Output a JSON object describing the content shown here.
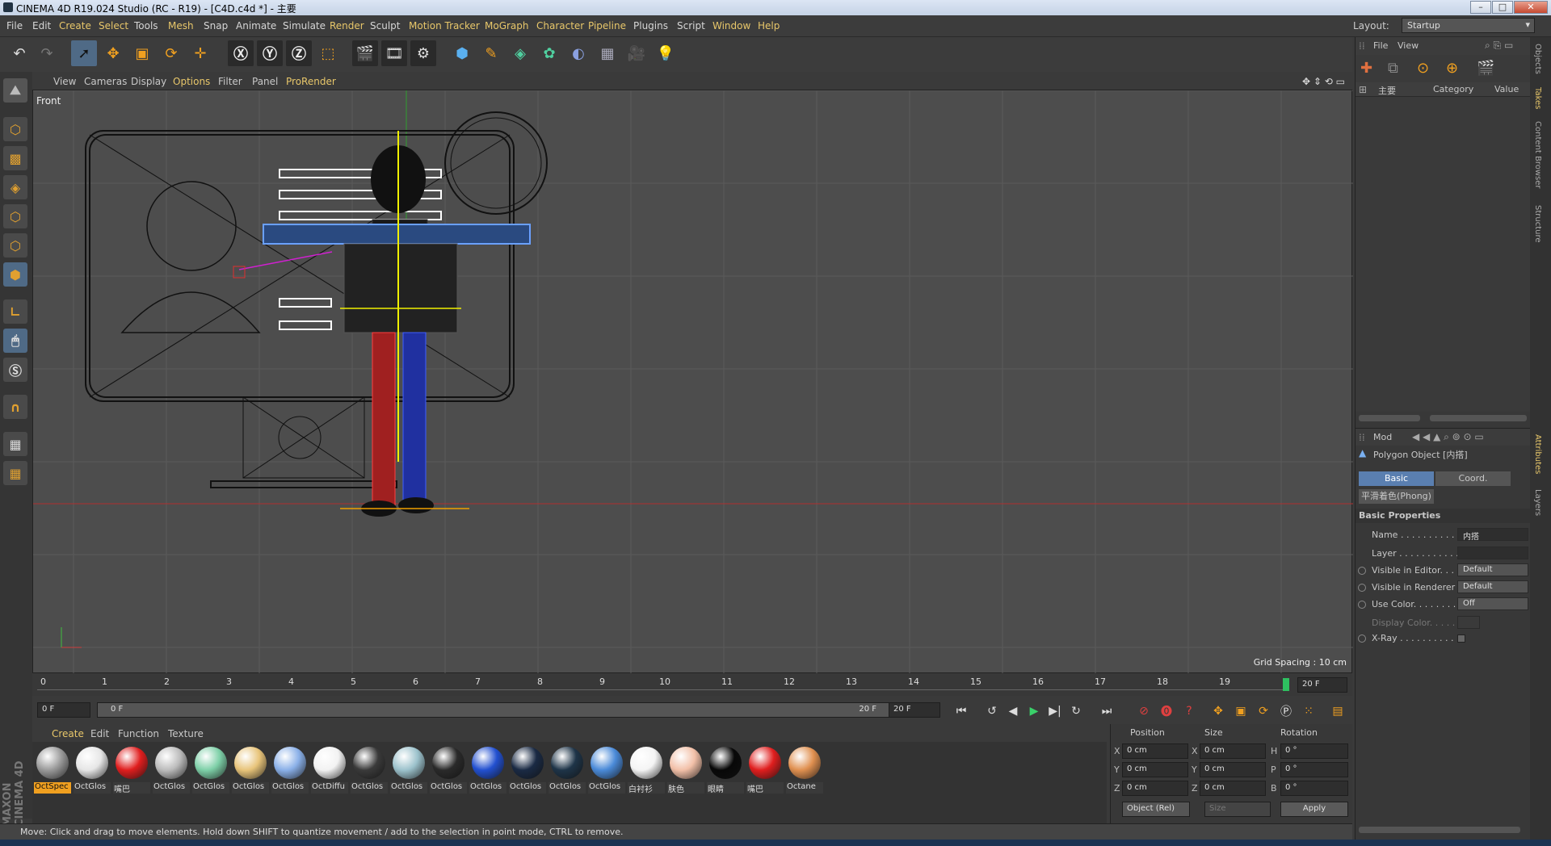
{
  "window": {
    "title": "CINEMA 4D R19.024 Studio (RC - R19) - [C4D.c4d *] - 主要"
  },
  "menu": {
    "items": [
      "File",
      "Edit",
      "Create",
      "Select",
      "Tools",
      "Mesh",
      "Snap",
      "Animate",
      "Simulate",
      "Render",
      "Sculpt",
      "Motion Tracker",
      "MoGraph",
      "Character",
      "Pipeline",
      "Plugins",
      "Script",
      "Window",
      "Help"
    ],
    "layout_label": "Layout:",
    "layout_value": "Startup"
  },
  "viewport": {
    "menu": [
      "View",
      "Cameras",
      "Display",
      "Options",
      "Filter",
      "Panel",
      "ProRender"
    ],
    "name": "Front",
    "grid_spacing": "Grid Spacing : 10 cm"
  },
  "timeline": {
    "ticks": [
      "0",
      "1",
      "2",
      "3",
      "4",
      "5",
      "6",
      "7",
      "8",
      "9",
      "10",
      "11",
      "12",
      "13",
      "14",
      "15",
      "16",
      "17",
      "18",
      "19"
    ],
    "current": "20 F"
  },
  "playbar": {
    "start": "0 F",
    "range_start": "0 F",
    "range_end": "20 F",
    "end": "20 F"
  },
  "materials": {
    "menu": [
      "Create",
      "Edit",
      "Function",
      "Texture"
    ],
    "items": [
      {
        "name": "OctSpec",
        "color": "#9a9a9a"
      },
      {
        "name": "OctGlos",
        "color": "#e6e6e6"
      },
      {
        "name": "嘴巴",
        "color": "#e01e1e"
      },
      {
        "name": "OctGlos",
        "color": "#bcbcbc"
      },
      {
        "name": "OctGlos",
        "color": "#7ed0a8"
      },
      {
        "name": "OctGlos",
        "color": "#e8c47a"
      },
      {
        "name": "OctGlos",
        "color": "#8ab0e8"
      },
      {
        "name": "OctDiffu",
        "color": "#f2f2f2"
      },
      {
        "name": "OctGlos",
        "color": "#3a3a3a"
      },
      {
        "name": "OctGlos",
        "color": "#9cc2cc"
      },
      {
        "name": "OctGlos",
        "color": "#2a2a2a"
      },
      {
        "name": "OctGlos",
        "color": "#2250d0"
      },
      {
        "name": "OctGlos",
        "color": "#1a2a44"
      },
      {
        "name": "OctGlos",
        "color": "#1e3448"
      },
      {
        "name": "OctGlos",
        "color": "#4a8ad8"
      },
      {
        "name": "白衬衫",
        "color": "#f4f4f4"
      },
      {
        "name": "肤色",
        "color": "#f2c0a8"
      },
      {
        "name": "眼睛",
        "color": "#080808"
      },
      {
        "name": "嘴巴",
        "color": "#e01e1e"
      },
      {
        "name": "Octane",
        "color": "#e09050"
      }
    ]
  },
  "coords": {
    "headers": [
      "Position",
      "Size",
      "Rotation"
    ],
    "rows": [
      {
        "a": "X",
        "pos": "0 cm",
        "sa": "X",
        "size": "0 cm",
        "ra": "H",
        "rot": "0 °"
      },
      {
        "a": "Y",
        "pos": "0 cm",
        "sa": "Y",
        "size": "0 cm",
        "ra": "P",
        "rot": "0 °"
      },
      {
        "a": "Z",
        "pos": "0 cm",
        "sa": "Z",
        "size": "0 cm",
        "ra": "B",
        "rot": "0 °"
      }
    ],
    "mode": "Object (Rel)",
    "size_mode": "Size",
    "apply": "Apply"
  },
  "status": "Move: Click and drag to move elements. Hold down SHIFT to quantize movement / add to the selection in point mode, CTRL to remove.",
  "takes": {
    "menu": [
      "File",
      "View"
    ],
    "col_main": "主要",
    "col_category": "Category",
    "col_value": "Value"
  },
  "attributes": {
    "mode": "Mod",
    "object_title": "Polygon Object [内搭]",
    "tabs": [
      "Basic",
      "Coord."
    ],
    "phong_tab": "平滑着色(Phong)",
    "section": "Basic Properties",
    "props": [
      {
        "label": "Name . . . . . . . . . . .",
        "value": "内搭"
      },
      {
        "label": "Layer . . . . . . . . . . .",
        "value": ""
      },
      {
        "label": "Visible in Editor. . .",
        "value": "Default"
      },
      {
        "label": "Visible in Renderer",
        "value": "Default"
      },
      {
        "label": "Use Color. . . . . . . .",
        "value": "Off"
      },
      {
        "label": "Display Color. . . . . .",
        "value": ""
      },
      {
        "label": "X-Ray . . . . . . . . . .",
        "value": ""
      }
    ]
  },
  "side_tabs": [
    "Objects",
    "Takes",
    "Content Browser",
    "Structure"
  ],
  "side_tabs_lower": [
    "Attributes",
    "Layers"
  ],
  "brand": "MAXON CINEMA 4D"
}
